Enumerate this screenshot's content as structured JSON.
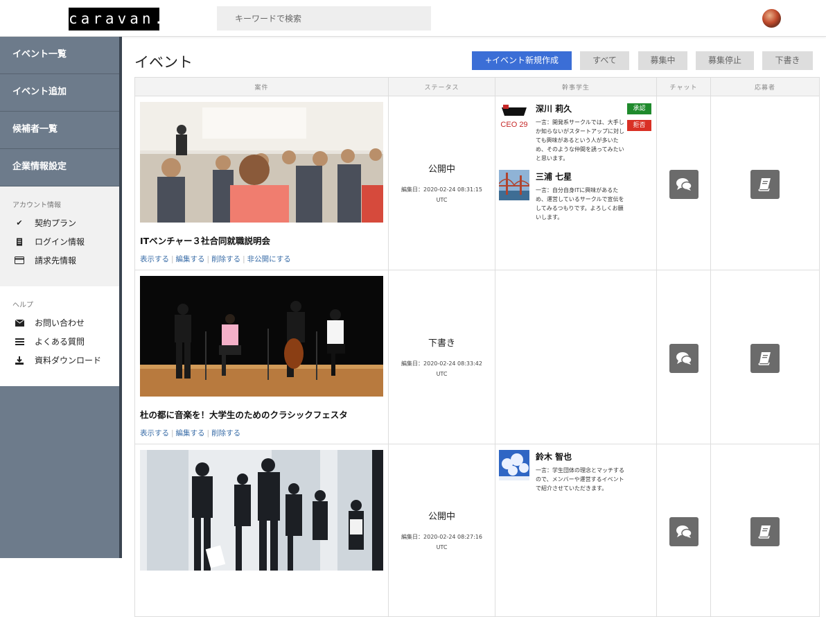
{
  "header": {
    "logo": "caravan.",
    "search_placeholder": "キーワードで検索"
  },
  "sidebar": {
    "nav": [
      {
        "label": "イベント一覧"
      },
      {
        "label": "イベント追加"
      },
      {
        "label": "候補者一覧"
      },
      {
        "label": "企業情報設定"
      }
    ],
    "account": {
      "title": "アカウント情報",
      "items": [
        {
          "label": "契約プラン",
          "icon": "check-icon"
        },
        {
          "label": "ログイン情報",
          "icon": "document-icon"
        },
        {
          "label": "請求先情報",
          "icon": "credit-card-icon"
        }
      ]
    },
    "help": {
      "title": "ヘルプ",
      "items": [
        {
          "label": "お問い合わせ",
          "icon": "envelope-icon"
        },
        {
          "label": "よくある質問",
          "icon": "list-icon"
        },
        {
          "label": "資料ダウンロード",
          "icon": "download-icon"
        }
      ]
    }
  },
  "main": {
    "title": "イベント",
    "create_button": "+イベント新規作成",
    "filters": [
      "すべて",
      "募集中",
      "募集停止",
      "下書き"
    ],
    "columns": [
      "案件",
      "ステータス",
      "幹事学生",
      "チャット",
      "応募者"
    ],
    "rows": [
      {
        "title": "ITベンチャー３社合同就職説明会",
        "links": [
          "表示する",
          "編集する",
          "削除する",
          "非公開にする"
        ],
        "status": "公開中",
        "edited": "編集日：2020-02-24 08:31:15",
        "tz": "UTC",
        "students": [
          {
            "name": "深川 莉久",
            "bio": "一言：開発系サークルでは、大手しか知らないがスタートアップに対しても興味があるという人が多いため、そのような仲間を誘ってみたいと思います。",
            "logo_text": "CEO 29",
            "approve": "承認",
            "reject": "拒否"
          },
          {
            "name": "三浦 七星",
            "bio": "一言：自分自身ITに興味があるため、運営しているサークルで宣伝をしてみるつもりです。よろしくお願いします。"
          }
        ]
      },
      {
        "title": "杜の都に音楽を！大学生のためのクラシックフェスタ",
        "links": [
          "表示する",
          "編集する",
          "削除する"
        ],
        "status": "下書き",
        "edited": "編集日：2020-02-24 08:33:42",
        "tz": "UTC",
        "students": []
      },
      {
        "title": "",
        "links": [],
        "status": "公開中",
        "edited": "編集日：2020-02-24 08:27:16",
        "tz": "UTC",
        "students": [
          {
            "name": "鈴木 智也",
            "bio": "一言：学生団体の理念とマッチするので、メンバーや運営するイベントで紹介させていただきます。"
          }
        ]
      }
    ]
  },
  "colors": {
    "sidebar_bg": "#6d7b8b",
    "primary": "#3b6ed6",
    "approve": "#1f8a2c",
    "reject": "#d93025",
    "link": "#3b6ea8"
  }
}
